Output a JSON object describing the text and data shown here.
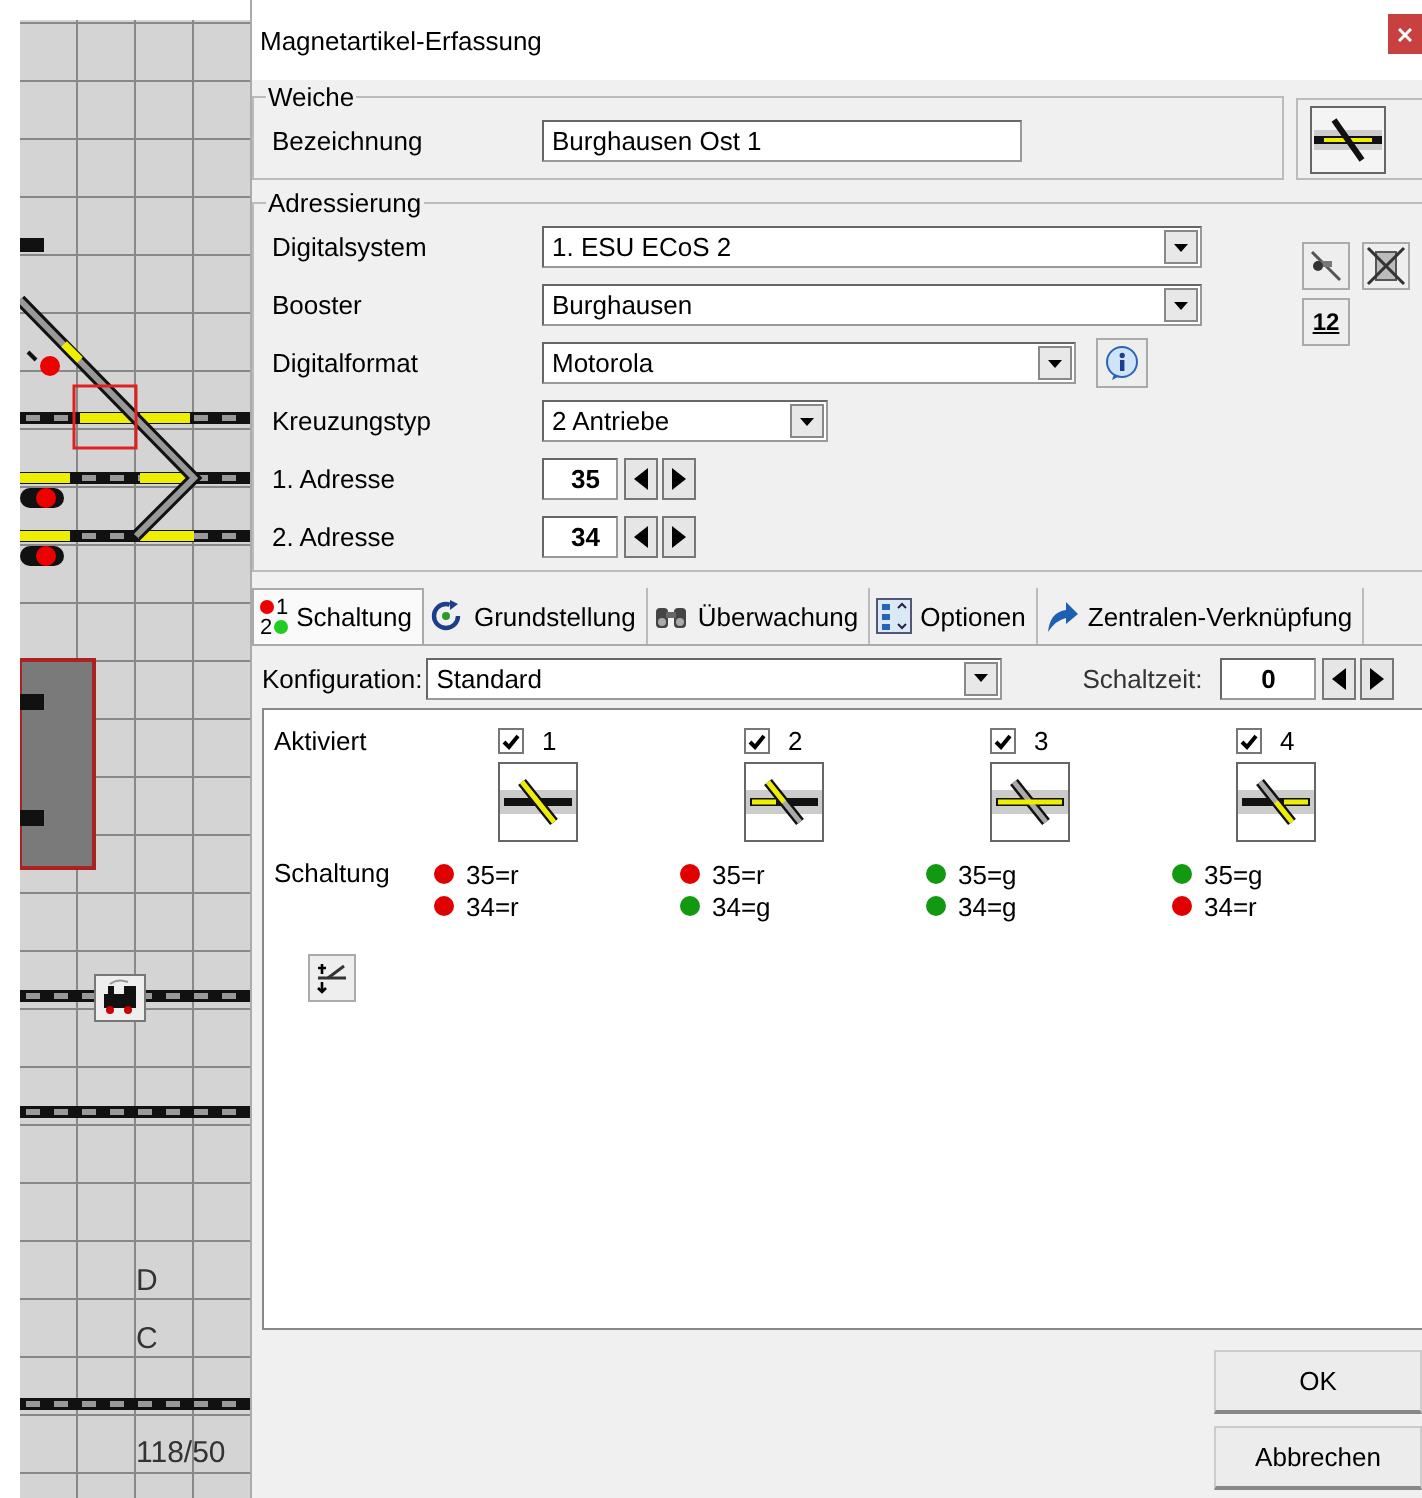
{
  "track_plan": {
    "labels": [
      {
        "text": "D"
      },
      {
        "text": "C"
      },
      {
        "text": "118/50"
      }
    ]
  },
  "dialog": {
    "title": "Magnetartikel-Erfassung",
    "weiche": {
      "legend": "Weiche",
      "label": "Bezeichnung",
      "value": "Burghausen Ost 1"
    },
    "adressierung": {
      "legend": "Adressierung",
      "fields": [
        {
          "kind": "select",
          "label": "Digitalsystem",
          "value": "1. ESU ECoS 2"
        },
        {
          "kind": "select",
          "label": "Booster",
          "value": "Burghausen"
        },
        {
          "kind": "select",
          "label": "Digitalformat",
          "value": "Motorola"
        },
        {
          "kind": "select",
          "label": "Kreuzungstyp",
          "value": "2 Antriebe"
        },
        {
          "kind": "spinner",
          "label": "1. Adresse",
          "value": "35"
        },
        {
          "kind": "spinner",
          "label": "2. Adresse",
          "value": "34"
        }
      ],
      "number_button": "12"
    },
    "tabs": [
      {
        "label": "Schaltung",
        "selected": true,
        "icon_digits": [
          "1",
          "2"
        ]
      },
      {
        "label": "Grundstellung",
        "selected": false
      },
      {
        "label": "Überwachung",
        "selected": false
      },
      {
        "label": "Optionen",
        "selected": false
      },
      {
        "label": "Zentralen-Verknüpfung",
        "selected": false
      }
    ],
    "konfiguration": {
      "label": "Konfiguration:",
      "value": "Standard"
    },
    "schaltzeit": {
      "label": "Schaltzeit:",
      "value": "0"
    },
    "aktiviert_label": "Aktiviert",
    "schaltung_label": "Schaltung",
    "positions": [
      {
        "label": "1",
        "checked": true,
        "states": [
          {
            "text": "35=r",
            "color": "#e00000"
          },
          {
            "text": "34=r",
            "color": "#e00000"
          }
        ]
      },
      {
        "label": "2",
        "checked": true,
        "states": [
          {
            "text": "35=r",
            "color": "#e00000"
          },
          {
            "text": "34=g",
            "color": "#119911"
          }
        ]
      },
      {
        "label": "3",
        "checked": true,
        "states": [
          {
            "text": "35=g",
            "color": "#119911"
          },
          {
            "text": "34=g",
            "color": "#119911"
          }
        ]
      },
      {
        "label": "4",
        "checked": true,
        "states": [
          {
            "text": "35=g",
            "color": "#119911"
          },
          {
            "text": "34=r",
            "color": "#e00000"
          }
        ]
      }
    ],
    "buttons": [
      "OK",
      "Abbrechen"
    ]
  }
}
